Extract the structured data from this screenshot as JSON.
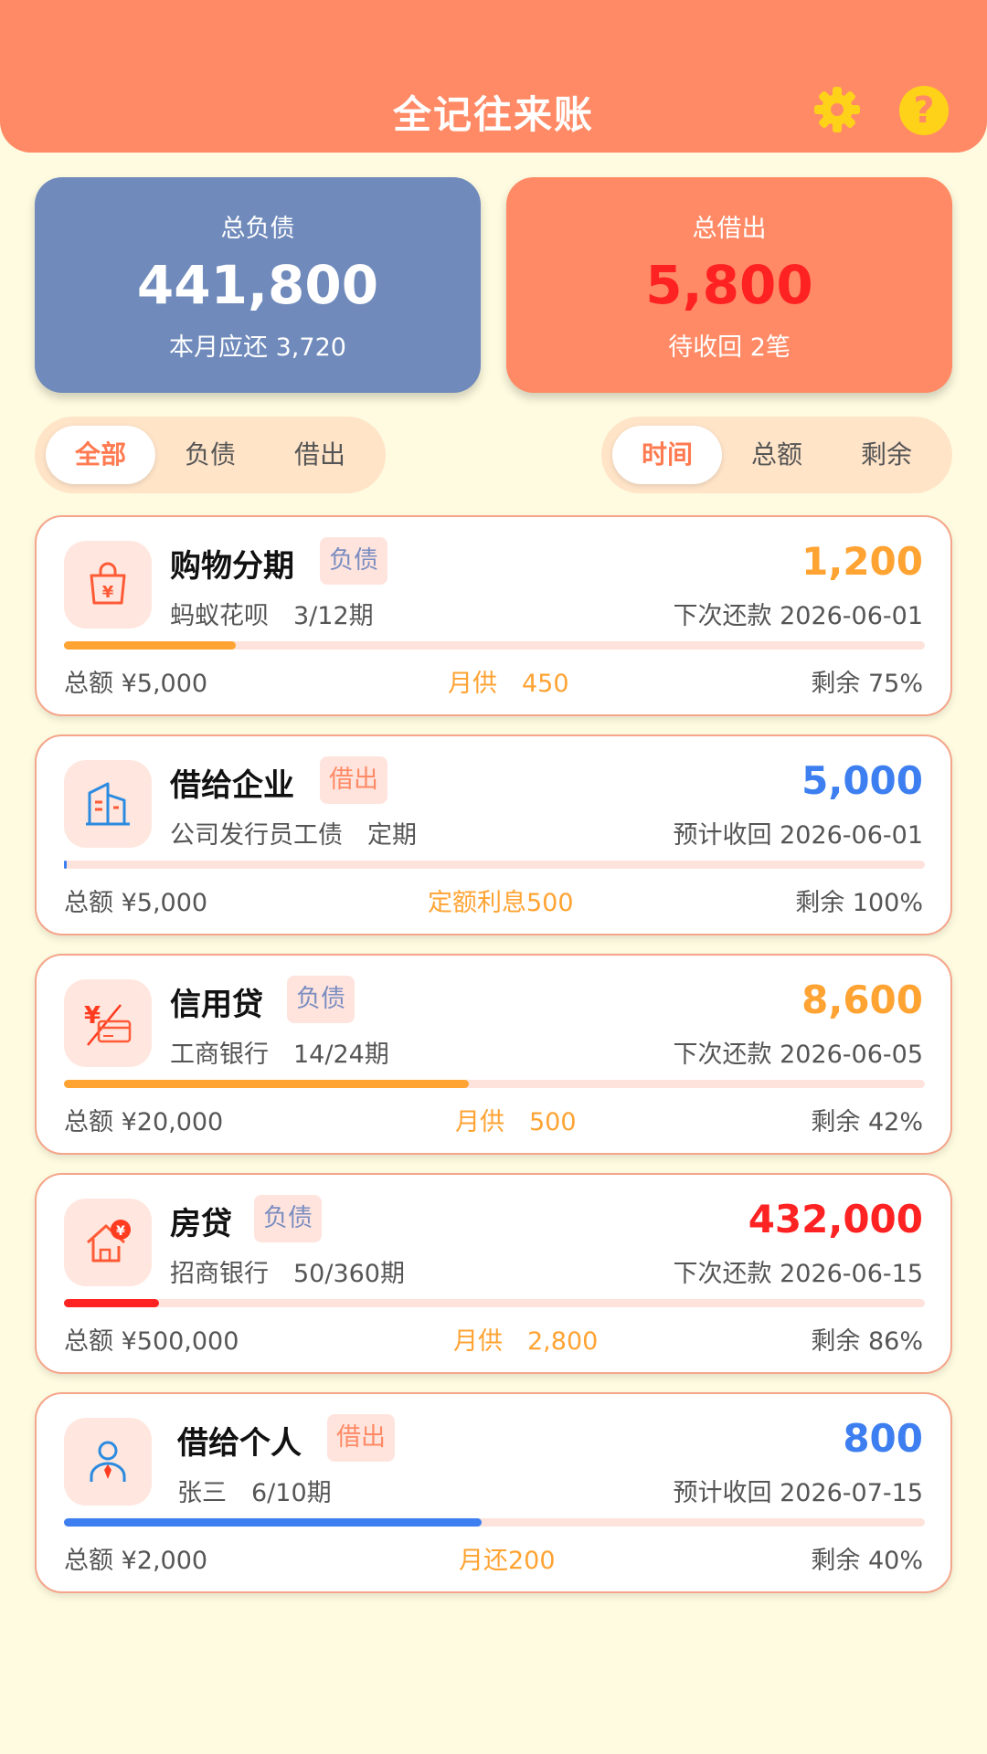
{
  "header": {
    "title": "全记往来账",
    "settings_icon": "gear-icon",
    "help_icon": "help-icon",
    "help_glyph": "?"
  },
  "summary": {
    "debt": {
      "label": "总负债",
      "value": "441,800",
      "sub": "本月应还 3,720"
    },
    "lend": {
      "label": "总借出",
      "value": "5,800",
      "sub": "待收回 2笔"
    }
  },
  "filter_tabs": [
    "全部",
    "负债",
    "借出"
  ],
  "sort_tabs": [
    "时间",
    "总额",
    "剩余"
  ],
  "colors": {
    "orange": "#ffa333",
    "blue": "#3d7ff0",
    "red": "#ff2222",
    "header": "#ff8a65",
    "debt_card": "#6f8abb"
  },
  "items": [
    {
      "title": "购物分期",
      "tag": "负债",
      "sub": "蚂蚁花呗　3/12期",
      "amount": "1,200",
      "date": "下次还款 2026-06-01",
      "total": "总额 ¥5,000",
      "mid": "月供　450",
      "remain": "剩余 75%",
      "progress": 0.2,
      "icon": "shopping-bag-icon"
    },
    {
      "title": "借给企业",
      "tag": "借出",
      "sub": "公司发行员工债　定期",
      "amount": "5,000",
      "date": "预计收回 2026-06-01",
      "total": "总额 ¥5,000",
      "mid": "定额利息500",
      "remain": "剩余 100%",
      "progress": 0.003,
      "icon": "building-icon"
    },
    {
      "title": "信用贷",
      "tag": "负债",
      "sub": "工商银行　14/24期",
      "amount": "8,600",
      "date": "下次还款 2026-06-05",
      "total": "总额 ¥20,000",
      "mid": "月供　500",
      "remain": "剩余 42%",
      "progress": 0.47,
      "icon": "credit-card-icon"
    },
    {
      "title": "房贷",
      "tag": "负债",
      "sub": "招商银行　50/360期",
      "amount": "432,000",
      "date": "下次还款 2026-06-15",
      "total": "总额 ¥500,000",
      "mid": "月供　2,800",
      "remain": "剩余 86%",
      "progress": 0.11,
      "icon": "house-loan-icon"
    },
    {
      "title": "借给个人",
      "tag": "借出",
      "sub": "张三　6/10期",
      "amount": "800",
      "date": "预计收回 2026-07-15",
      "total": "总额 ¥2,000",
      "mid": "月还200",
      "remain": "剩余 40%",
      "progress": 0.485,
      "icon": "person-icon"
    }
  ]
}
